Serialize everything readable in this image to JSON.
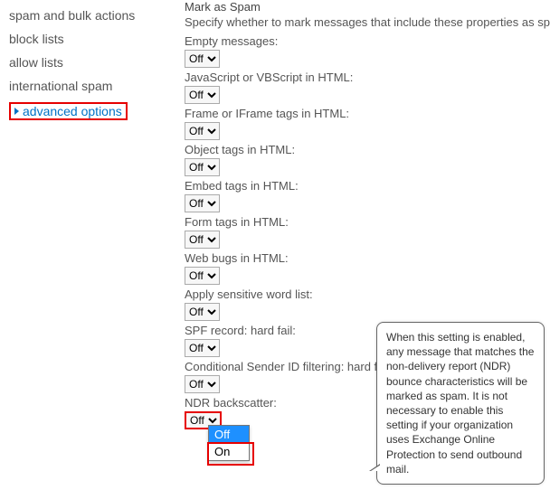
{
  "sidebar": {
    "items": [
      {
        "label": "spam and bulk actions"
      },
      {
        "label": "block lists"
      },
      {
        "label": "allow lists"
      },
      {
        "label": "international spam"
      },
      {
        "label": "advanced options"
      }
    ]
  },
  "main": {
    "title": "Mark as Spam",
    "description": "Specify whether to mark messages that include these properties as spam.",
    "option_off": "Off",
    "option_on": "On",
    "settings": [
      {
        "label": "Empty messages:",
        "value": "Off"
      },
      {
        "label": "JavaScript or VBScript in HTML:",
        "value": "Off"
      },
      {
        "label": "Frame or IFrame tags in HTML:",
        "value": "Off"
      },
      {
        "label": "Object tags in HTML:",
        "value": "Off"
      },
      {
        "label": "Embed tags in HTML:",
        "value": "Off"
      },
      {
        "label": "Form tags in HTML:",
        "value": "Off"
      },
      {
        "label": "Web bugs in HTML:",
        "value": "Off"
      },
      {
        "label": "Apply sensitive word list:",
        "value": "Off"
      },
      {
        "label": "SPF record: hard fail:",
        "value": "Off"
      },
      {
        "label": "Conditional Sender ID filtering: hard fail:",
        "value": "Off"
      },
      {
        "label": "NDR backscatter:",
        "value": "Off"
      }
    ]
  },
  "tooltip": {
    "text": "When this setting is enabled, any message that matches the non-delivery report (NDR) bounce characteristics will be marked as spam. It is not necessary to enable this setting if your organization uses Exchange Online Protection to send outbound mail."
  }
}
